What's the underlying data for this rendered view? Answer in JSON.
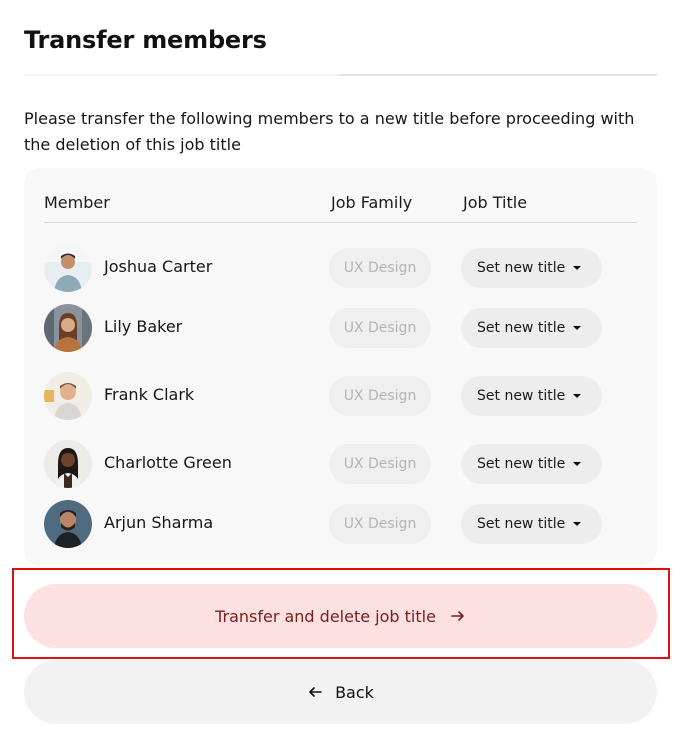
{
  "header": {
    "title": "Transfer members"
  },
  "description": "Please transfer the following members to a new title before proceeding with the deletion of this job title",
  "table": {
    "columns": {
      "member": "Member",
      "job_family": "Job Family",
      "job_title": "Job Title"
    },
    "rows": [
      {
        "name": "Joshua Carter",
        "job_family": "UX Design",
        "job_title": "Set new title"
      },
      {
        "name": "Lily Baker",
        "job_family": "UX Design",
        "job_title": "Set new title"
      },
      {
        "name": "Frank Clark",
        "job_family": "UX Design",
        "job_title": "Set new title"
      },
      {
        "name": "Charlotte Green",
        "job_family": "UX Design",
        "job_title": "Set new title"
      },
      {
        "name": "Arjun Sharma",
        "job_family": "UX Design",
        "job_title": "Set new title"
      }
    ]
  },
  "actions": {
    "primary_label": "Transfer and delete job title",
    "primary_icon": "arrow-right-icon",
    "secondary_label": "Back",
    "secondary_icon": "arrow-left-icon"
  },
  "colors": {
    "primary_bg": "#fde1e1",
    "primary_text": "#7a1d1d",
    "highlight_border": "#e01010",
    "panel_bg": "#f8f8f8"
  }
}
